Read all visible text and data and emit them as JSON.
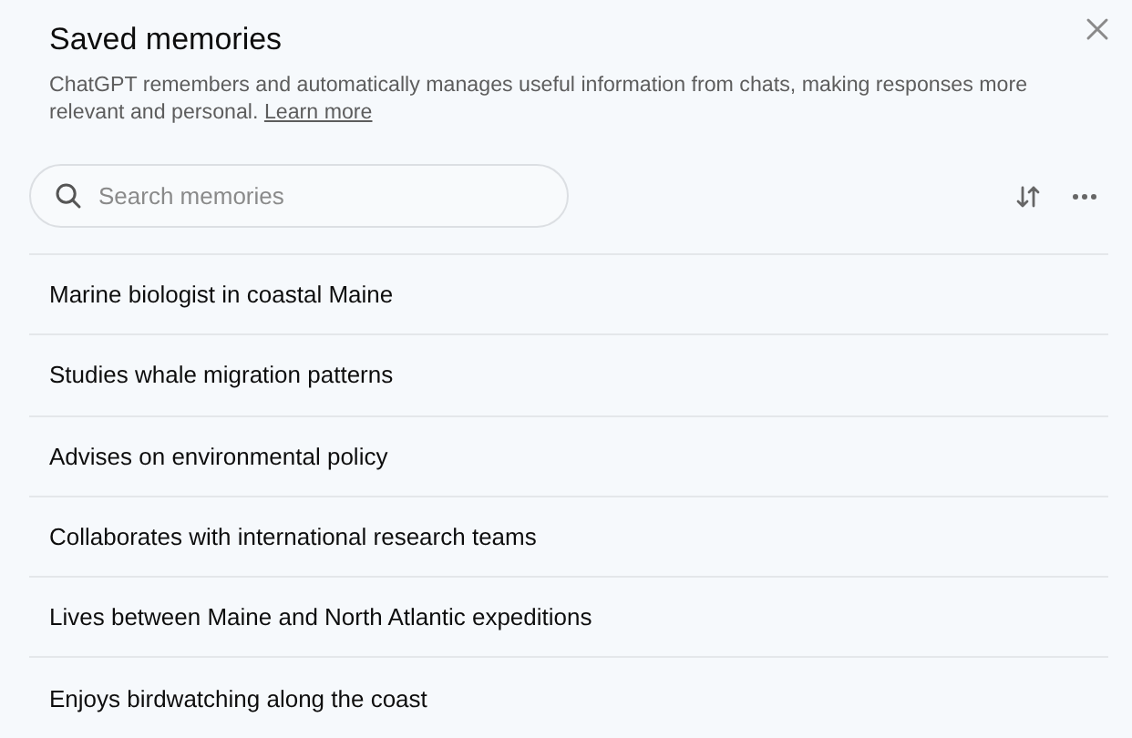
{
  "dialog": {
    "title": "Saved memories",
    "description": "ChatGPT remembers and automatically manages useful information from chats, making responses more relevant and personal.",
    "link": "Learn more"
  },
  "search": {
    "placeholder": "Search memories"
  },
  "memories": [
    {
      "text": "Marine biologist in coastal Maine"
    },
    {
      "text": "Studies whale migration patterns"
    },
    {
      "text": "Advises on environmental policy"
    },
    {
      "text": "Collaborates with international research teams"
    },
    {
      "text": "Lives between Maine and North Atlantic expeditions"
    },
    {
      "text": "Enjoys birdwatching along the coast"
    }
  ]
}
